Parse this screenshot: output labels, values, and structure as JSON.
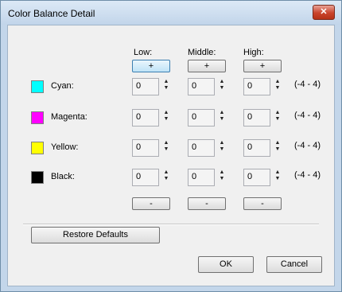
{
  "window": {
    "title": "Color Balance Detail",
    "close_glyph": "✕"
  },
  "columns": {
    "low": "Low:",
    "middle": "Middle:",
    "high": "High:"
  },
  "plus_label": "+",
  "minus_label": "-",
  "rows": [
    {
      "label": "Cyan:",
      "color": "#00ffff",
      "low": "0",
      "middle": "0",
      "high": "0",
      "range": "(-4 - 4)"
    },
    {
      "label": "Magenta:",
      "color": "#ff00ff",
      "low": "0",
      "middle": "0",
      "high": "0",
      "range": "(-4 - 4)"
    },
    {
      "label": "Yellow:",
      "color": "#ffff00",
      "low": "0",
      "middle": "0",
      "high": "0",
      "range": "(-4 - 4)"
    },
    {
      "label": "Black:",
      "color": "#000000",
      "low": "0",
      "middle": "0",
      "high": "0",
      "range": "(-4 - 4)"
    }
  ],
  "buttons": {
    "restore": "Restore Defaults",
    "ok": "OK",
    "cancel": "Cancel"
  },
  "spin_up": "▲",
  "spin_down": "▼"
}
